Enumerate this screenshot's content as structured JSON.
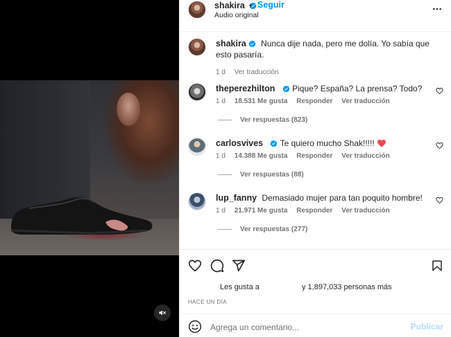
{
  "post": {
    "username": "shakira",
    "dot": "•",
    "follow_label": "Seguir",
    "audio": "Audio original"
  },
  "caption": {
    "username": "shakira",
    "text": "Nunca dije nada, pero me dolía. Yo sabía que esto pasaría.",
    "time": "1 d",
    "translate": "Ver traducción"
  },
  "comments": [
    {
      "username": "theperezhilton",
      "text": "Pique? España? La prensa? Todo?",
      "time": "1 d",
      "likes": "18.531 Me gusta",
      "reply": "Responder",
      "translate": "Ver traducción",
      "replies": "Ver respuestas (823)"
    },
    {
      "username": "carlosvives",
      "text": "Te quiero mucho Shak!!!!!",
      "time": "1 d",
      "likes": "14.388 Me gusta",
      "reply": "Responder",
      "translate": "Ver traducción",
      "replies": "Ver respuestas (88)"
    },
    {
      "username": "lup_fanny",
      "text": "Demasiado mujer para tan poquito hombre!",
      "time": "1 d",
      "likes": "21.971 Me gusta",
      "reply": "Responder",
      "translate": "Ver traducción",
      "replies": "Ver respuestas (277)"
    }
  ],
  "engagement": {
    "likes_prefix": "Les gusta a",
    "likes_suffix": "y 1,897,033 personas más",
    "time_ago": "HACE UN DÍA"
  },
  "composer": {
    "placeholder": "Agrega un comentario...",
    "post_label": "Publicar"
  },
  "icons": {
    "more": "more-horizontal-icon",
    "verified": "verified-badge-icon",
    "heart": "heart-icon",
    "comment": "comment-icon",
    "share": "share-icon",
    "save": "bookmark-icon",
    "emoji": "emoji-icon",
    "mute": "speaker-muted-icon"
  },
  "colors": {
    "accent": "#0095f6",
    "verified": "#0095f6",
    "heart_red": "#ed4956"
  }
}
